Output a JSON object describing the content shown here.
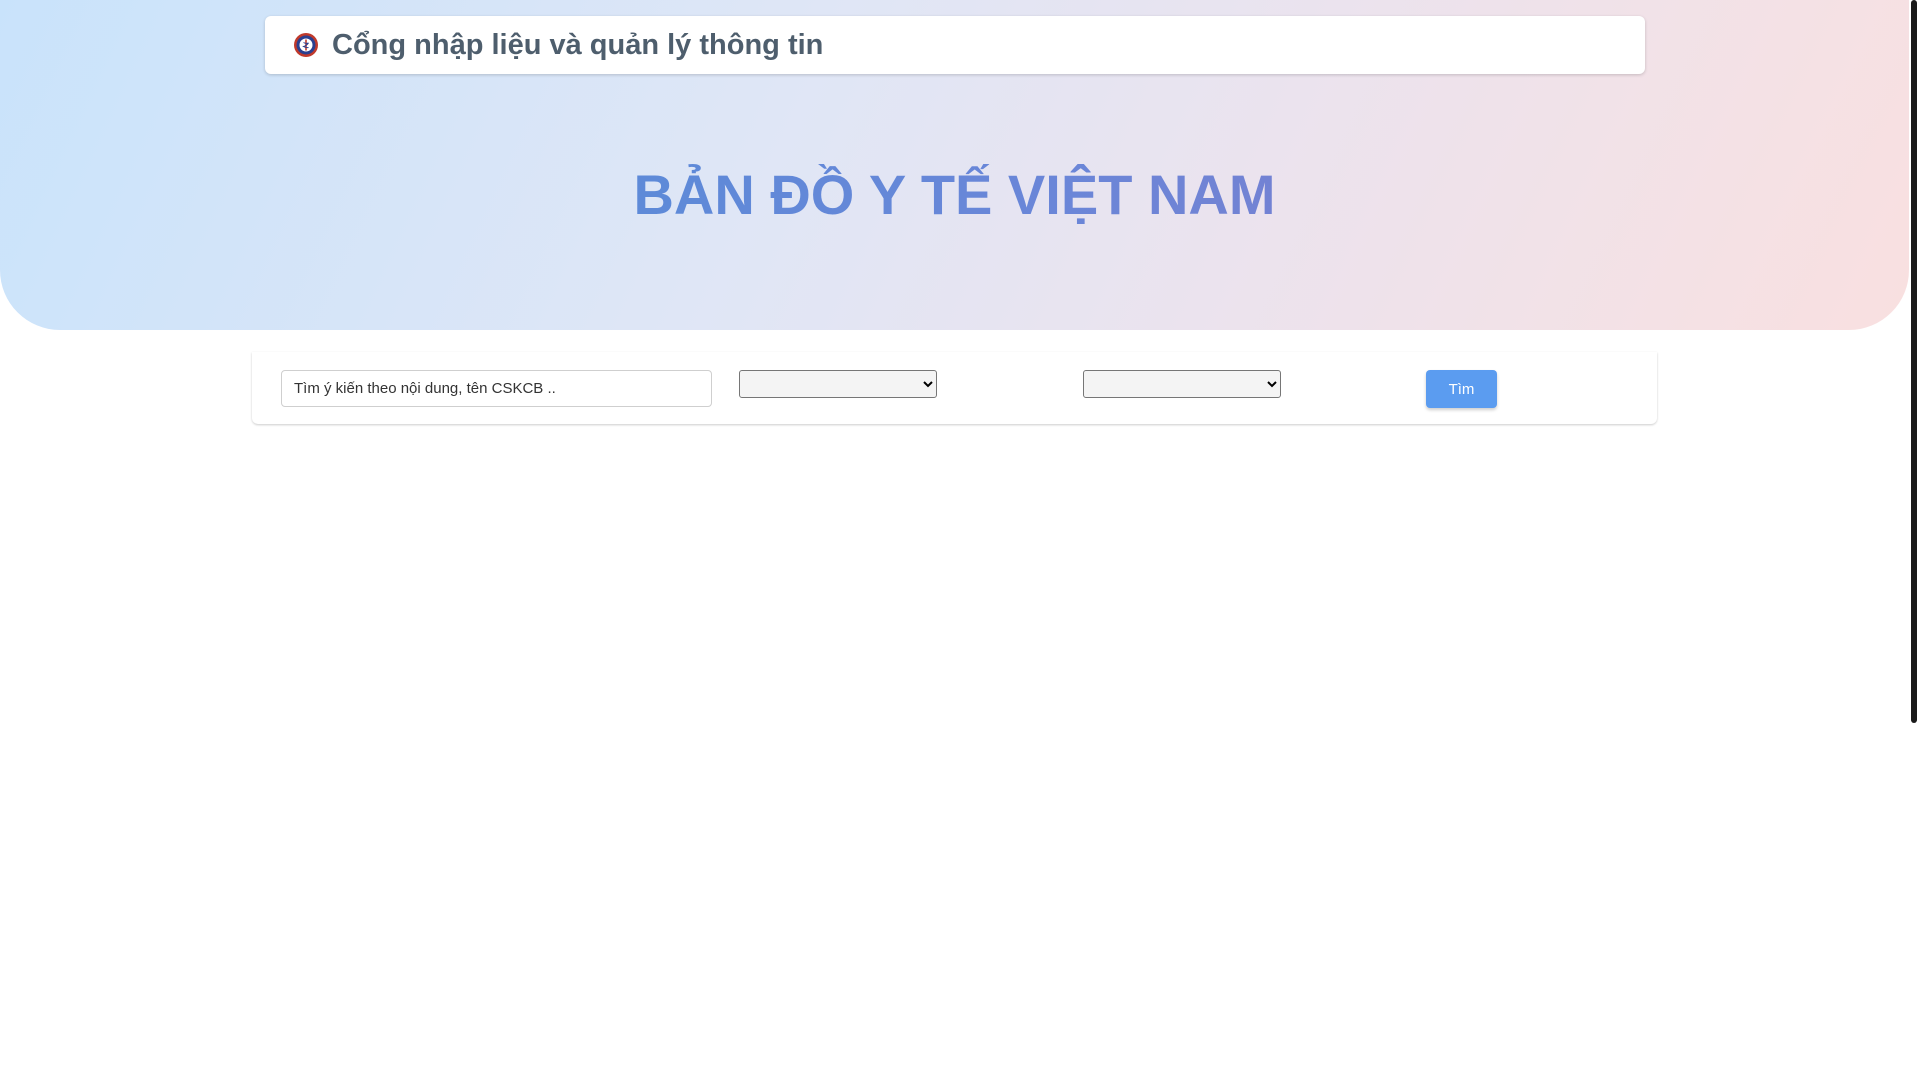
{
  "header": {
    "logo_icon": "ministry-of-health-logo-icon",
    "title": "Cổng nhập liệu và quản lý thông tin"
  },
  "hero": {
    "title": "BẢN ĐỒ Y TẾ VIỆT NAM"
  },
  "search": {
    "placeholder": "Tìm ý kiến theo nội dung, tên CSKCB ..",
    "value": "",
    "filter_1_value": "",
    "filter_2_value": "",
    "button_label": "Tìm"
  },
  "colors": {
    "accent": "#5b9cf0",
    "hero_title_start": "#4a90d9",
    "hero_title_end": "#8a78c6",
    "header_text": "#4e5e6d"
  }
}
